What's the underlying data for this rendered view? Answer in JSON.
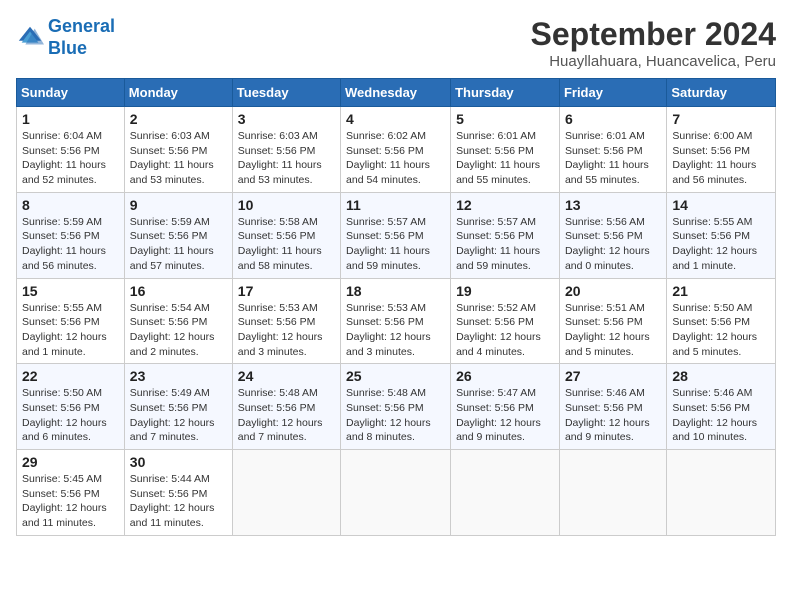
{
  "header": {
    "logo_line1": "General",
    "logo_line2": "Blue",
    "month": "September 2024",
    "location": "Huayllahuara, Huancavelica, Peru"
  },
  "weekdays": [
    "Sunday",
    "Monday",
    "Tuesday",
    "Wednesday",
    "Thursday",
    "Friday",
    "Saturday"
  ],
  "weeks": [
    [
      {
        "day": 1,
        "sunrise": "6:04 AM",
        "sunset": "5:56 PM",
        "daylight": "11 hours and 52 minutes."
      },
      {
        "day": 2,
        "sunrise": "6:03 AM",
        "sunset": "5:56 PM",
        "daylight": "11 hours and 53 minutes."
      },
      {
        "day": 3,
        "sunrise": "6:03 AM",
        "sunset": "5:56 PM",
        "daylight": "11 hours and 53 minutes."
      },
      {
        "day": 4,
        "sunrise": "6:02 AM",
        "sunset": "5:56 PM",
        "daylight": "11 hours and 54 minutes."
      },
      {
        "day": 5,
        "sunrise": "6:01 AM",
        "sunset": "5:56 PM",
        "daylight": "11 hours and 55 minutes."
      },
      {
        "day": 6,
        "sunrise": "6:01 AM",
        "sunset": "5:56 PM",
        "daylight": "11 hours and 55 minutes."
      },
      {
        "day": 7,
        "sunrise": "6:00 AM",
        "sunset": "5:56 PM",
        "daylight": "11 hours and 56 minutes."
      }
    ],
    [
      {
        "day": 8,
        "sunrise": "5:59 AM",
        "sunset": "5:56 PM",
        "daylight": "11 hours and 56 minutes."
      },
      {
        "day": 9,
        "sunrise": "5:59 AM",
        "sunset": "5:56 PM",
        "daylight": "11 hours and 57 minutes."
      },
      {
        "day": 10,
        "sunrise": "5:58 AM",
        "sunset": "5:56 PM",
        "daylight": "11 hours and 58 minutes."
      },
      {
        "day": 11,
        "sunrise": "5:57 AM",
        "sunset": "5:56 PM",
        "daylight": "11 hours and 59 minutes."
      },
      {
        "day": 12,
        "sunrise": "5:57 AM",
        "sunset": "5:56 PM",
        "daylight": "11 hours and 59 minutes."
      },
      {
        "day": 13,
        "sunrise": "5:56 AM",
        "sunset": "5:56 PM",
        "daylight": "12 hours and 0 minutes."
      },
      {
        "day": 14,
        "sunrise": "5:55 AM",
        "sunset": "5:56 PM",
        "daylight": "12 hours and 1 minute."
      }
    ],
    [
      {
        "day": 15,
        "sunrise": "5:55 AM",
        "sunset": "5:56 PM",
        "daylight": "12 hours and 1 minute."
      },
      {
        "day": 16,
        "sunrise": "5:54 AM",
        "sunset": "5:56 PM",
        "daylight": "12 hours and 2 minutes."
      },
      {
        "day": 17,
        "sunrise": "5:53 AM",
        "sunset": "5:56 PM",
        "daylight": "12 hours and 3 minutes."
      },
      {
        "day": 18,
        "sunrise": "5:53 AM",
        "sunset": "5:56 PM",
        "daylight": "12 hours and 3 minutes."
      },
      {
        "day": 19,
        "sunrise": "5:52 AM",
        "sunset": "5:56 PM",
        "daylight": "12 hours and 4 minutes."
      },
      {
        "day": 20,
        "sunrise": "5:51 AM",
        "sunset": "5:56 PM",
        "daylight": "12 hours and 5 minutes."
      },
      {
        "day": 21,
        "sunrise": "5:50 AM",
        "sunset": "5:56 PM",
        "daylight": "12 hours and 5 minutes."
      }
    ],
    [
      {
        "day": 22,
        "sunrise": "5:50 AM",
        "sunset": "5:56 PM",
        "daylight": "12 hours and 6 minutes."
      },
      {
        "day": 23,
        "sunrise": "5:49 AM",
        "sunset": "5:56 PM",
        "daylight": "12 hours and 7 minutes."
      },
      {
        "day": 24,
        "sunrise": "5:48 AM",
        "sunset": "5:56 PM",
        "daylight": "12 hours and 7 minutes."
      },
      {
        "day": 25,
        "sunrise": "5:48 AM",
        "sunset": "5:56 PM",
        "daylight": "12 hours and 8 minutes."
      },
      {
        "day": 26,
        "sunrise": "5:47 AM",
        "sunset": "5:56 PM",
        "daylight": "12 hours and 9 minutes."
      },
      {
        "day": 27,
        "sunrise": "5:46 AM",
        "sunset": "5:56 PM",
        "daylight": "12 hours and 9 minutes."
      },
      {
        "day": 28,
        "sunrise": "5:46 AM",
        "sunset": "5:56 PM",
        "daylight": "12 hours and 10 minutes."
      }
    ],
    [
      {
        "day": 29,
        "sunrise": "5:45 AM",
        "sunset": "5:56 PM",
        "daylight": "12 hours and 11 minutes."
      },
      {
        "day": 30,
        "sunrise": "5:44 AM",
        "sunset": "5:56 PM",
        "daylight": "12 hours and 11 minutes."
      },
      null,
      null,
      null,
      null,
      null
    ]
  ]
}
